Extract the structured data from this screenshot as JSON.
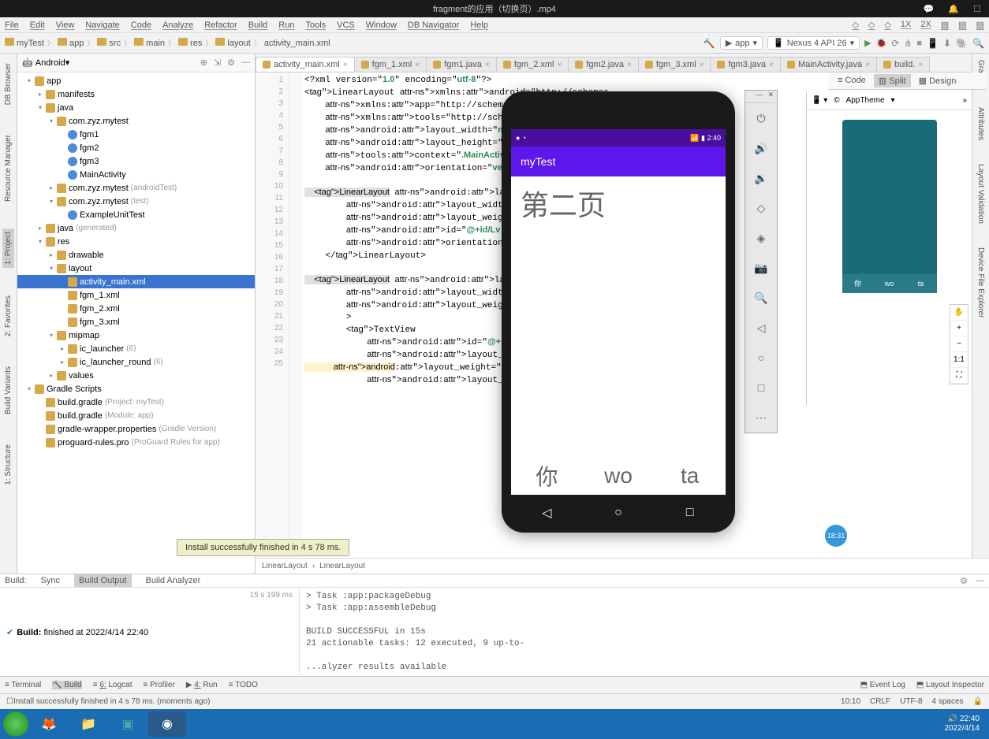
{
  "titlebar": {
    "text": "fragment的应用（切换页）.mp4"
  },
  "menu": [
    "File",
    "Edit",
    "View",
    "Navigate",
    "Code",
    "Analyze",
    "Refactor",
    "Build",
    "Run",
    "Tools",
    "VCS",
    "Window",
    "DB Navigator",
    "Help"
  ],
  "toolbar_right_labels": [
    "1X",
    "2X"
  ],
  "breadcrumb": [
    "myTest",
    "app",
    "src",
    "main",
    "res",
    "layout",
    "activity_main.xml"
  ],
  "run_config": {
    "app": "app",
    "device": "Nexus 4 API 26"
  },
  "project_panel": {
    "title": "Android",
    "tree": [
      {
        "d": 0,
        "t": "app",
        "i": "module",
        "a": "v"
      },
      {
        "d": 1,
        "t": "manifests",
        "i": "folder",
        "a": ">"
      },
      {
        "d": 1,
        "t": "java",
        "i": "folder",
        "a": "v"
      },
      {
        "d": 2,
        "t": "com.zyz.mytest",
        "i": "pkg",
        "a": "v"
      },
      {
        "d": 3,
        "t": "fgm1",
        "i": "java"
      },
      {
        "d": 3,
        "t": "fgm2",
        "i": "java"
      },
      {
        "d": 3,
        "t": "fgm3",
        "i": "java"
      },
      {
        "d": 3,
        "t": "MainActivity",
        "i": "java"
      },
      {
        "d": 2,
        "t": "com.zyz.mytest",
        "m": "(androidTest)",
        "i": "pkg",
        "a": ">"
      },
      {
        "d": 2,
        "t": "com.zyz.mytest",
        "m": "(test)",
        "i": "pkg",
        "a": "v"
      },
      {
        "d": 3,
        "t": "ExampleUnitTest",
        "i": "java"
      },
      {
        "d": 1,
        "t": "java",
        "m": "(generated)",
        "i": "folder",
        "a": ">"
      },
      {
        "d": 1,
        "t": "res",
        "i": "folder",
        "a": "v"
      },
      {
        "d": 2,
        "t": "drawable",
        "i": "folder",
        "a": ">"
      },
      {
        "d": 2,
        "t": "layout",
        "i": "folder",
        "a": "v"
      },
      {
        "d": 3,
        "t": "activity_main.xml",
        "i": "xml",
        "sel": true
      },
      {
        "d": 3,
        "t": "fgm_1.xml",
        "i": "xml"
      },
      {
        "d": 3,
        "t": "fgm_2.xml",
        "i": "xml"
      },
      {
        "d": 3,
        "t": "fgm_3.xml",
        "i": "xml"
      },
      {
        "d": 2,
        "t": "mipmap",
        "i": "folder",
        "a": "v"
      },
      {
        "d": 3,
        "t": "ic_launcher",
        "m": "(6)",
        "i": "folder",
        "a": ">"
      },
      {
        "d": 3,
        "t": "ic_launcher_round",
        "m": "(6)",
        "i": "folder",
        "a": ">"
      },
      {
        "d": 2,
        "t": "values",
        "i": "folder",
        "a": ">"
      },
      {
        "d": 0,
        "t": "Gradle Scripts",
        "i": "gradle",
        "a": "v"
      },
      {
        "d": 1,
        "t": "build.gradle",
        "m": "(Project: myTest)",
        "i": "gradle"
      },
      {
        "d": 1,
        "t": "build.gradle",
        "m": "(Module: app)",
        "i": "gradle"
      },
      {
        "d": 1,
        "t": "gradle-wrapper.properties",
        "m": "(Gradle Version)",
        "i": "gradle"
      },
      {
        "d": 1,
        "t": "proguard-rules.pro",
        "m": "(ProGuard Rules for app)",
        "i": "gradle"
      }
    ]
  },
  "tabs": [
    {
      "label": "activity_main.xml",
      "active": true
    },
    {
      "label": "fgm_1.xml"
    },
    {
      "label": "fgm1.java"
    },
    {
      "label": "fgm_2.xml"
    },
    {
      "label": "fgm2.java"
    },
    {
      "label": "fgm_3.xml"
    },
    {
      "label": "fgm3.java"
    },
    {
      "label": "MainActivity.java"
    },
    {
      "label": "build."
    }
  ],
  "view_modes": {
    "code": "Code",
    "split": "Split",
    "design": "Design"
  },
  "code_lines": [
    "<?xml version=\"1.0\" encoding=\"utf-8\"?>",
    "<LinearLayout xmlns:android=\"http://schemas",
    "    xmlns:app=\"http://schemas.android.com",
    "    xmlns:tools=\"http://schemas.android.c",
    "    android:layout_width=\"match_parent\"",
    "    android:layout_height=\"match_parent\"",
    "    tools:context=\".MainActivity\"",
    "    android:orientation=\"vertical\">",
    "",
    "    <LinearLayout android:layout_height=\"0d",
    "        android:layout_width=\"match_parent",
    "        android:layout_weight=\"8\"",
    "        android:id=\"@+id/Lv\"",
    "        android:orientation=\"horizontal\">",
    "    </LinearLayout>",
    "",
    "    <LinearLayout android:layout_height=\"0",
    "        android:layout_width=\"match_parent",
    "        android:layout_weight=\"2\"",
    "        >",
    "        <TextView",
    "            android:id=\"@+id/tv1\"",
    "            android:layout_width=\"0dp\"",
    "            android:layout_weight=\"1\"",
    "            android:layout_height=\"match_p"
  ],
  "editor_breadcrumb": [
    "LinearLayout",
    "LinearLayout"
  ],
  "build": {
    "tabs_label_build": "Build:",
    "tabs": [
      "Sync",
      "Build Output",
      "Build Analyzer"
    ],
    "status": "Build: finished at 2022/4/14 22:40",
    "duration": "15 s 199 ms",
    "output": [
      "> Task :app:packageDebug",
      "> Task :app:assembleDebug",
      "",
      "BUILD SUCCESSFUL in 15s",
      "21 actionable tasks: 12 executed, 9 up-to-",
      "",
      "...alyzer results available"
    ]
  },
  "bottom_bar": {
    "items": [
      "Terminal",
      "Build",
      "Logcat",
      "Profiler",
      "Run",
      "TODO"
    ],
    "prefixes": [
      "",
      "",
      "6:",
      "",
      "4:",
      ""
    ],
    "right": [
      "Event Log",
      "Layout Inspector"
    ]
  },
  "statusbar": {
    "left": "Install successfully finished in 4 s 78 ms. (moments ago)",
    "right": [
      "10:10",
      "CRLF",
      "UTF-8",
      "4 spaces"
    ]
  },
  "tooltip": "Install successfully finished in 4 s 78 ms.",
  "emulator": {
    "status_time": "2:40",
    "app_title": "myTest",
    "page_title": "第二页",
    "tabs": [
      "你",
      "wo",
      "ta"
    ]
  },
  "design": {
    "theme": "AppTheme",
    "tabs": [
      "你",
      "wo",
      "ta"
    ],
    "zoom": [
      "+",
      "−",
      "1:1"
    ]
  },
  "badge": "18:31",
  "taskbar_time": {
    "time": "22:40",
    "date": "2022/4/14"
  },
  "left_rail": [
    "DB Browser",
    "Resource Manager",
    "1: Project",
    "2: Favorites",
    "Build Variants",
    "1: Structure"
  ],
  "right_rail": [
    "Gradle",
    "Attributes",
    "Layout Validation",
    "Device File Explorer"
  ]
}
